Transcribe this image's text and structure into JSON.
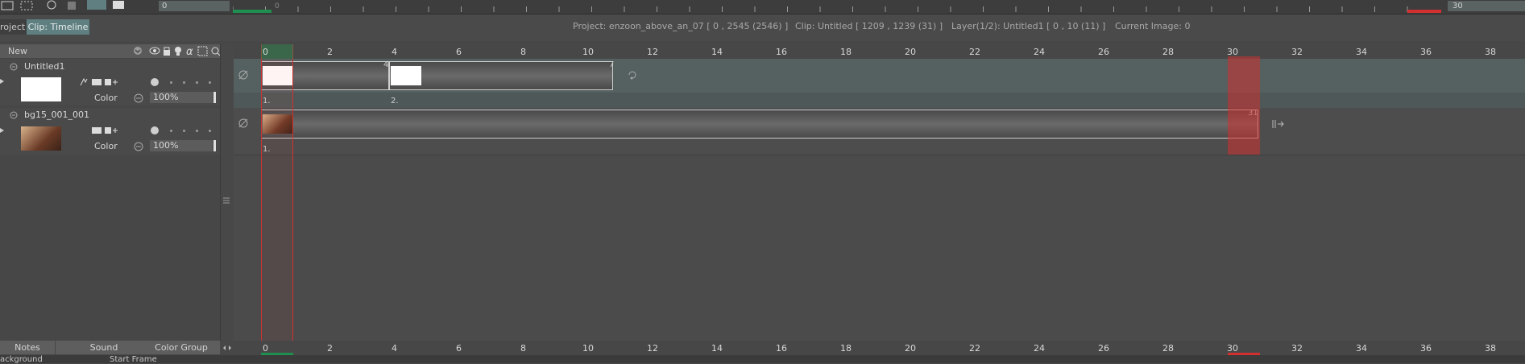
{
  "toolbar": {
    "frame_value": "0",
    "end_value": "30"
  },
  "tabs": {
    "project": "roject",
    "timeline": "Clip: Timeline"
  },
  "info": {
    "project": "Project: enzoon_above_an_07 [ 0 , 2545  (2546) ]",
    "clip": "Clip: Untitled [ 1209 , 1239  (31) ]",
    "layer": "Layer(1/2): Untitled1 [ 0 , 10  (11) ]",
    "image": "Current Image: 0"
  },
  "layers_header": {
    "new_label": "New"
  },
  "layers": [
    {
      "name": "Untitled1",
      "mode": "Color",
      "opacity": "100%"
    },
    {
      "name": "bg15_001_001",
      "mode": "Color",
      "opacity": "100%"
    }
  ],
  "bottom_tabs": {
    "notes": "Notes",
    "sound": "Sound",
    "color_group": "Color Group"
  },
  "bottom_fields": {
    "background": "ackground",
    "start_frame": "Start Frame"
  },
  "ruler": {
    "labels": [
      "0",
      "2",
      "4",
      "6",
      "8",
      "10",
      "12",
      "14",
      "16",
      "18",
      "20",
      "22",
      "24",
      "26",
      "28",
      "30",
      "32",
      "34",
      "36",
      "38"
    ],
    "top_mini_start": "0"
  },
  "cells": {
    "track1": [
      {
        "start_label": "",
        "num": "1."
      },
      {
        "start_label": "4",
        "num": "2.",
        "end_label": "7"
      }
    ],
    "track2": [
      {
        "num": "1.",
        "end_label": "31"
      }
    ]
  },
  "colors": {
    "accent": "#5f7f80",
    "playhead": "#d23030",
    "current": "#1f8f50"
  }
}
